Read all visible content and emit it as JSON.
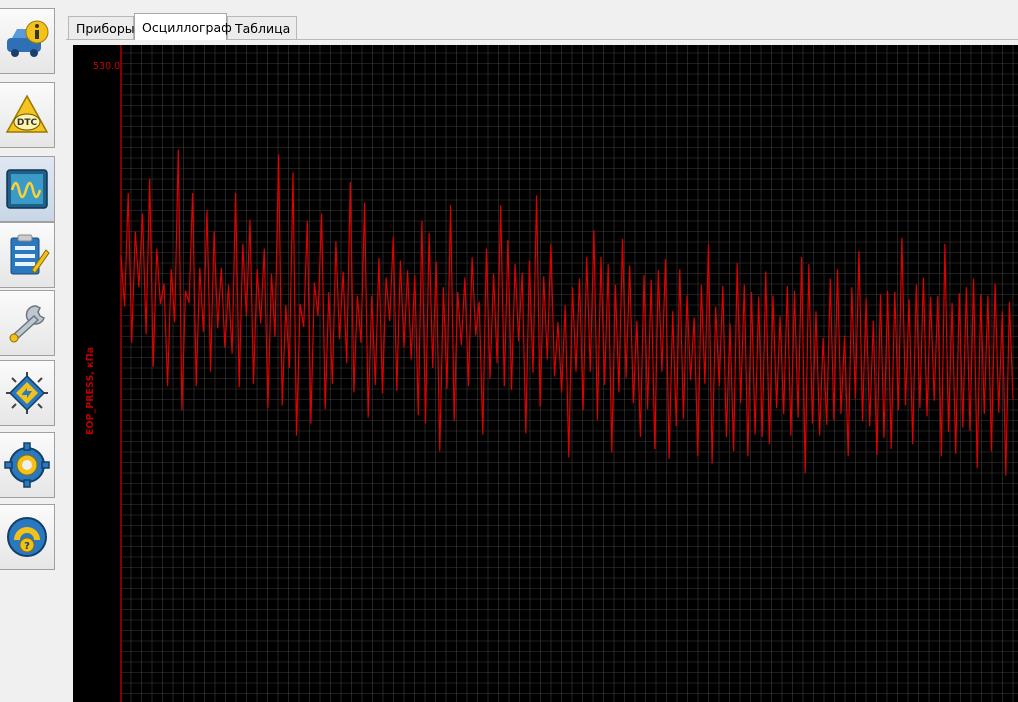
{
  "app": {
    "sidebar": [
      {
        "name": "vehicle-info-icon"
      },
      {
        "name": "dtc-icon",
        "text": "DTC"
      },
      {
        "name": "oscilloscope-icon"
      },
      {
        "name": "checklist-icon"
      },
      {
        "name": "wrench-icon"
      },
      {
        "name": "chip-icon"
      },
      {
        "name": "gear-icon"
      },
      {
        "name": "help-icon"
      }
    ],
    "tabs": [
      {
        "label": "Приборы"
      },
      {
        "label": "Осциллограф"
      },
      {
        "label": "Таблица"
      }
    ],
    "active_tab": 1
  },
  "colors": {
    "plot_bg": "#000000",
    "grid": "#3c3c3c",
    "trace": "#e00000",
    "axis": "#b00000"
  },
  "chart_data": {
    "type": "line",
    "ylabel": "EOP_PRESS, кПа",
    "ytop_label": "530.0",
    "ylim": [
      0,
      530
    ],
    "grid": true,
    "series": [
      {
        "values": [
          372,
          330,
          424,
          300,
          392,
          346,
          407,
          307,
          436,
          280,
          378,
          332,
          349,
          264,
          361,
          317,
          460,
          244,
          343,
          333,
          424,
          264,
          362,
          309,
          410,
          276,
          392,
          312,
          362,
          296,
          348,
          291,
          424,
          263,
          382,
          322,
          402,
          266,
          361,
          316,
          378,
          246,
          357,
          305,
          456,
          248,
          331,
          279,
          441,
          223,
          332,
          313,
          401,
          233,
          350,
          322,
          407,
          245,
          342,
          266,
          384,
          303,
          359,
          283,
          433,
          259,
          339,
          300,
          416,
          238,
          339,
          265,
          370,
          258,
          354,
          318,
          388,
          260,
          368,
          296,
          360,
          286,
          356,
          240,
          401,
          233,
          391,
          279,
          367,
          210,
          346,
          262,
          414,
          235,
          342,
          298,
          354,
          264,
          371,
          306,
          334,
          224,
          378,
          270,
          357,
          283,
          414,
          264,
          385,
          261,
          365,
          301,
          358,
          225,
          368,
          275,
          422,
          247,
          355,
          286,
          382,
          272,
          317,
          259,
          331,
          205,
          346,
          276,
          353,
          244,
          371,
          276,
          393,
          236,
          371,
          265,
          365,
          209,
          348,
          259,
          386,
          271,
          364,
          250,
          318,
          222,
          356,
          245,
          352,
          212,
          360,
          276,
          369,
          204,
          326,
          231,
          361,
          237,
          339,
          269,
          321,
          206,
          348,
          266,
          382,
          200,
          330,
          264,
          347,
          222,
          316,
          210,
          366,
          250,
          348,
          206,
          342,
          224,
          338,
          222,
          359,
          216,
          339,
          246,
          322,
          241,
          347,
          223,
          343,
          238,
          371,
          192,
          365,
          233,
          326,
          223,
          304,
          232,
          353,
          236,
          361,
          241,
          306,
          206,
          346,
          254,
          376,
          235,
          337,
          231,
          318,
          207,
          340,
          221,
          343,
          212,
          342,
          244,
          387,
          248,
          336,
          216,
          348,
          246,
          354,
          239,
          338,
          252,
          339,
          206,
          382,
          226,
          333,
          208,
          341,
          230,
          346,
          227,
          353,
          196,
          340,
          241,
          339,
          210,
          349,
          242,
          326,
          190,
          334,
          253
        ]
      }
    ]
  }
}
